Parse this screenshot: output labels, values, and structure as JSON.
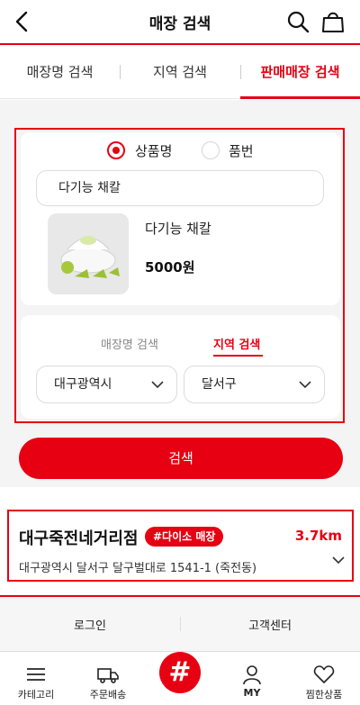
{
  "header": {
    "title": "매장 검색"
  },
  "tabs": [
    {
      "label": "매장명 검색"
    },
    {
      "label": "지역 검색"
    },
    {
      "label": "판매매장 검색"
    }
  ],
  "search_type": {
    "options": [
      {
        "label": "상품명",
        "selected": true
      },
      {
        "label": "품번",
        "selected": false
      }
    ]
  },
  "query": {
    "value": "다기능 채칼"
  },
  "product": {
    "name": "다기능 채칼",
    "price": "5000원"
  },
  "sub_tabs": [
    {
      "label": "매장명 검색"
    },
    {
      "label": "지역 검색"
    }
  ],
  "filters": {
    "city": "대구광역시",
    "district": "달서구"
  },
  "search_button": {
    "label": "검색"
  },
  "result": {
    "name": "대구죽전네거리점",
    "badge": "#다이소 매장",
    "distance": "3.7km",
    "address": "대구광역시 달서구 달구벌대로 1541-1 (죽전동)"
  },
  "footer": {
    "login": "로그인",
    "support": "고객센터"
  },
  "bottom_nav": [
    {
      "label": "카테고리",
      "icon": "menu-icon"
    },
    {
      "label": "주문배송",
      "icon": "truck-icon"
    },
    {
      "label": "#",
      "icon": "hashtag-icon"
    },
    {
      "label": "MY",
      "icon": "person-icon"
    },
    {
      "label": "찜한상품",
      "icon": "heart-icon"
    }
  ],
  "colors": {
    "brand": "#e60012"
  }
}
